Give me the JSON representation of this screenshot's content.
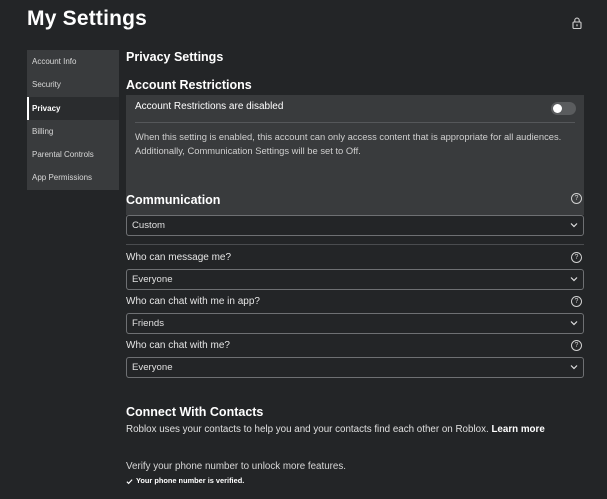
{
  "page": {
    "title": "My Settings",
    "lock_icon": "lock-icon"
  },
  "sidebar": {
    "items": [
      {
        "label": "Account Info",
        "active": false
      },
      {
        "label": "Security",
        "active": false
      },
      {
        "label": "Privacy",
        "active": true
      },
      {
        "label": "Billing",
        "active": false
      },
      {
        "label": "Parental Controls",
        "active": false
      },
      {
        "label": "App Permissions",
        "active": false
      }
    ]
  },
  "privacy": {
    "heading": "Privacy Settings",
    "account_restrictions": {
      "heading": "Account Restrictions",
      "toggle_label": "Account Restrictions are disabled",
      "toggle_on": false,
      "description": "When this setting is enabled, this account can only access content that is appropriate for all audiences. Additionally, Communication Settings will be set to Off."
    },
    "communication": {
      "heading": "Communication",
      "help_icon": "question-circle-icon",
      "preset_value": "Custom",
      "questions": [
        {
          "label": "Who can message me?",
          "value": "Everyone"
        },
        {
          "label": "Who can chat with me in app?",
          "value": "Friends"
        },
        {
          "label": "Who can chat with me?",
          "value": "Everyone"
        }
      ]
    },
    "contacts": {
      "heading": "Connect With Contacts",
      "description": "Roblox uses your contacts to help you and your contacts find each other on Roblox.",
      "learn_more": "Learn more",
      "verify_text": "Verify your phone number to unlock more features.",
      "verified_text": "Your phone number is verified."
    }
  }
}
